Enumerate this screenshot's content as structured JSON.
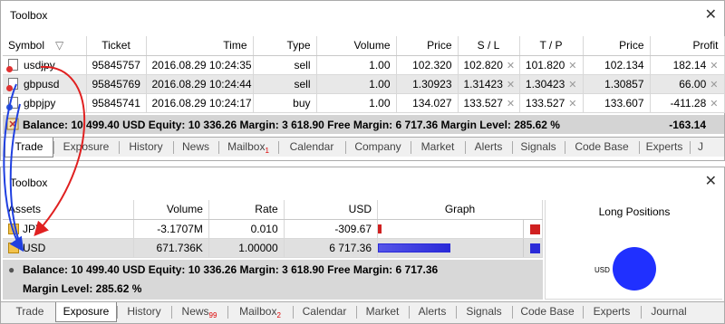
{
  "top": {
    "title": "Toolbox",
    "columns": [
      "Symbol",
      "Ticket",
      "Time",
      "Type",
      "Volume",
      "Price",
      "S / L",
      "T / P",
      "Price",
      "Profit"
    ],
    "orders": [
      {
        "symbol": "usdjpy",
        "ticket": "95845757",
        "time": "2016.08.29 10:24:35",
        "type": "sell",
        "volume": "1.00",
        "price": "102.320",
        "sl": "102.820",
        "tp": "101.820",
        "cur_price": "102.134",
        "profit": "182.14",
        "dot": "red"
      },
      {
        "symbol": "gbpusd",
        "ticket": "95845769",
        "time": "2016.08.29 10:24:44",
        "type": "sell",
        "volume": "1.00",
        "price": "1.30923",
        "sl": "1.31423",
        "tp": "1.30423",
        "cur_price": "1.30857",
        "profit": "66.00",
        "dot": "red"
      },
      {
        "symbol": "gbpjpy",
        "ticket": "95845741",
        "time": "2016.08.29 10:24:17",
        "type": "buy",
        "volume": "1.00",
        "price": "134.027",
        "sl": "133.527",
        "tp": "133.527",
        "cur_price": "133.607",
        "profit": "-411.28",
        "dot": "blue"
      }
    ],
    "balance_text": "Balance: 10 499.40 USD  Equity: 10 336.26  Margin: 3 618.90  Free Margin: 6 717.36  Margin Level: 285.62 %",
    "balance_profit": "-163.14",
    "tabs": [
      {
        "label": "Trade"
      },
      {
        "label": "Exposure"
      },
      {
        "label": "History"
      },
      {
        "label": "News"
      },
      {
        "label": "Mailbox",
        "badge": "1"
      },
      {
        "label": "Calendar"
      },
      {
        "label": "Company"
      },
      {
        "label": "Market"
      },
      {
        "label": "Alerts"
      },
      {
        "label": "Signals"
      },
      {
        "label": "Code Base"
      },
      {
        "label": "Experts"
      },
      {
        "label": "J"
      }
    ],
    "active_tab": "Trade"
  },
  "bottom": {
    "title": "Toolbox",
    "columns": [
      "Assets",
      "Volume",
      "Rate",
      "USD",
      "Graph"
    ],
    "assets": [
      {
        "asset": "JPY",
        "volume": "-3.1707M",
        "rate": "0.010",
        "usd": "-309.67",
        "graph_fraction": 0.046,
        "color": "#d02020"
      },
      {
        "asset": "USD",
        "volume": "671.736K",
        "rate": "1.00000",
        "usd": "6 717.36",
        "graph_fraction": 1.0,
        "color": "#2a2ad8"
      }
    ],
    "balance_line1": "Balance: 10 499.40 USD  Equity: 10 336.26  Margin: 3 618.90  Free Margin: 6 717.36",
    "balance_line2": "Margin Level: 285.62 %",
    "long_positions_title": "Long Positions",
    "pie_label": "USD",
    "tabs": [
      {
        "label": "Trade"
      },
      {
        "label": "Exposure"
      },
      {
        "label": "History"
      },
      {
        "label": "News",
        "badge": "99"
      },
      {
        "label": "Mailbox",
        "badge": "2"
      },
      {
        "label": "Calendar"
      },
      {
        "label": "Market"
      },
      {
        "label": "Alerts"
      },
      {
        "label": "Signals"
      },
      {
        "label": "Code Base"
      },
      {
        "label": "Experts"
      },
      {
        "label": "Journal"
      }
    ],
    "active_tab": "Exposure"
  },
  "colors": {
    "red_arrow": "#e02020",
    "blue_arrow": "#2040e0",
    "pie": "#2030ff"
  }
}
